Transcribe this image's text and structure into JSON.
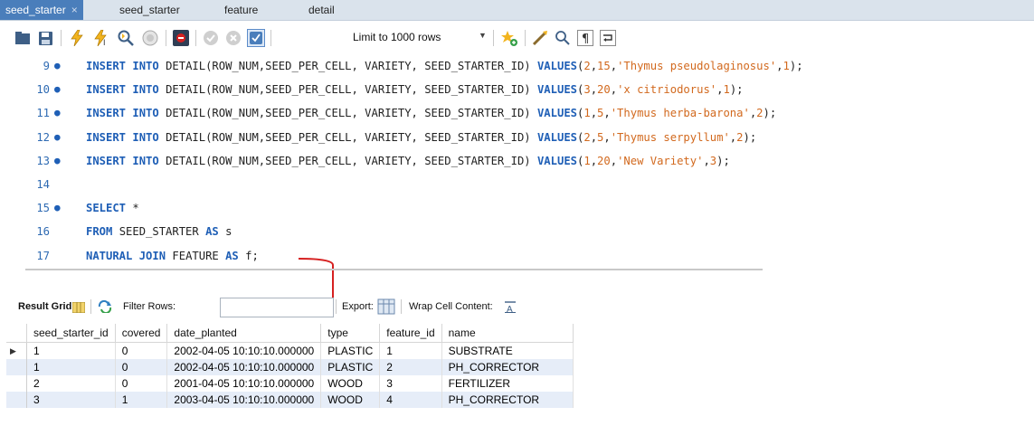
{
  "tabs": [
    {
      "label": "seed_starter",
      "active": true,
      "close": "×"
    },
    {
      "label": "seed_starter",
      "active": false
    },
    {
      "label": "feature",
      "active": false
    },
    {
      "label": "detail",
      "active": false
    }
  ],
  "toolbar": {
    "icons": [
      "open-folder-icon",
      "save-icon",
      "execute-icon",
      "execute-current-icon",
      "explain-icon",
      "stop-icon",
      "toggle-stop-on-error-icon",
      "commit-icon",
      "rollback-icon",
      "autocommit-icon",
      "beautify-icon",
      "find-icon",
      "invisible-chars-icon",
      "wrap-icon",
      "add-snippet-icon"
    ],
    "limit_label": "Limit to 1000 rows"
  },
  "editor": {
    "lines": [
      {
        "num": "9",
        "dot": true,
        "tokens": [
          [
            "kw",
            "INSERT INTO "
          ],
          [
            "plain",
            "DETAIL(ROW_NUM,SEED_PER_CELL, VARIETY, SEED_STARTER_ID) "
          ],
          [
            "kw",
            "VALUES"
          ],
          [
            "plain",
            "("
          ],
          [
            "num",
            "2"
          ],
          [
            "plain",
            ","
          ],
          [
            "num",
            "15"
          ],
          [
            "plain",
            ","
          ],
          [
            "str",
            "'Thymus pseudolaginosus'"
          ],
          [
            "plain",
            ","
          ],
          [
            "num",
            "1"
          ],
          [
            "plain",
            ");"
          ]
        ]
      },
      {
        "num": "10",
        "dot": true,
        "tokens": [
          [
            "kw",
            "INSERT INTO "
          ],
          [
            "plain",
            "DETAIL(ROW_NUM,SEED_PER_CELL, VARIETY, SEED_STARTER_ID) "
          ],
          [
            "kw",
            "VALUES"
          ],
          [
            "plain",
            "("
          ],
          [
            "num",
            "3"
          ],
          [
            "plain",
            ","
          ],
          [
            "num",
            "20"
          ],
          [
            "plain",
            ","
          ],
          [
            "str",
            "'x citriodorus'"
          ],
          [
            "plain",
            ","
          ],
          [
            "num",
            "1"
          ],
          [
            "plain",
            ");"
          ]
        ]
      },
      {
        "num": "11",
        "dot": true,
        "tokens": [
          [
            "kw",
            "INSERT INTO "
          ],
          [
            "plain",
            "DETAIL(ROW_NUM,SEED_PER_CELL, VARIETY, SEED_STARTER_ID) "
          ],
          [
            "kw",
            "VALUES"
          ],
          [
            "plain",
            "("
          ],
          [
            "num",
            "1"
          ],
          [
            "plain",
            ","
          ],
          [
            "num",
            "5"
          ],
          [
            "plain",
            ","
          ],
          [
            "str",
            "'Thymus herba-barona'"
          ],
          [
            "plain",
            ","
          ],
          [
            "num",
            "2"
          ],
          [
            "plain",
            ");"
          ]
        ]
      },
      {
        "num": "12",
        "dot": true,
        "tokens": [
          [
            "kw",
            "INSERT INTO "
          ],
          [
            "plain",
            "DETAIL(ROW_NUM,SEED_PER_CELL, VARIETY, SEED_STARTER_ID) "
          ],
          [
            "kw",
            "VALUES"
          ],
          [
            "plain",
            "("
          ],
          [
            "num",
            "2"
          ],
          [
            "plain",
            ","
          ],
          [
            "num",
            "5"
          ],
          [
            "plain",
            ","
          ],
          [
            "str",
            "'Thymus serpyllum'"
          ],
          [
            "plain",
            ","
          ],
          [
            "num",
            "2"
          ],
          [
            "plain",
            ");"
          ]
        ]
      },
      {
        "num": "13",
        "dot": true,
        "tokens": [
          [
            "kw",
            "INSERT INTO "
          ],
          [
            "plain",
            "DETAIL(ROW_NUM,SEED_PER_CELL, VARIETY, SEED_STARTER_ID) "
          ],
          [
            "kw",
            "VALUES"
          ],
          [
            "plain",
            "("
          ],
          [
            "num",
            "1"
          ],
          [
            "plain",
            ","
          ],
          [
            "num",
            "20"
          ],
          [
            "plain",
            ","
          ],
          [
            "str",
            "'New Variety'"
          ],
          [
            "plain",
            ","
          ],
          [
            "num",
            "3"
          ],
          [
            "plain",
            ");"
          ]
        ]
      },
      {
        "num": "14",
        "dot": false,
        "tokens": []
      },
      {
        "num": "15",
        "dot": true,
        "tokens": [
          [
            "kw",
            "SELECT "
          ],
          [
            "plain",
            "*"
          ]
        ]
      },
      {
        "num": "16",
        "dot": false,
        "tokens": [
          [
            "kw",
            "FROM "
          ],
          [
            "plain",
            "SEED_STARTER "
          ],
          [
            "kw",
            "AS "
          ],
          [
            "plain",
            "s"
          ]
        ]
      },
      {
        "num": "17",
        "dot": false,
        "tokens": [
          [
            "kw",
            "NATURAL JOIN "
          ],
          [
            "plain",
            "FEATURE "
          ],
          [
            "kw",
            "AS "
          ],
          [
            "plain",
            "f;"
          ]
        ]
      }
    ],
    "annotation_color": "#d62020"
  },
  "result": {
    "result_grid_label": "Result Grid",
    "filter_label": "Filter Rows:",
    "filter_value": "",
    "export_label": "Export:",
    "wrap_label": "Wrap Cell Content:",
    "columns": [
      "seed_starter_id",
      "covered",
      "date_planted",
      "type",
      "feature_id",
      "name"
    ],
    "rows": [
      [
        "1",
        "0",
        "2002-04-05 10:10:10.000000",
        "PLASTIC",
        "1",
        "SUBSTRATE"
      ],
      [
        "1",
        "0",
        "2002-04-05 10:10:10.000000",
        "PLASTIC",
        "2",
        "PH_CORRECTOR"
      ],
      [
        "2",
        "0",
        "2001-04-05 10:10:10.000000",
        "WOOD",
        "3",
        "FERTILIZER"
      ],
      [
        "3",
        "1",
        "2003-04-05 10:10:10.000000",
        "WOOD",
        "4",
        "PH_CORRECTOR"
      ]
    ],
    "current_row_marker": "▶"
  }
}
